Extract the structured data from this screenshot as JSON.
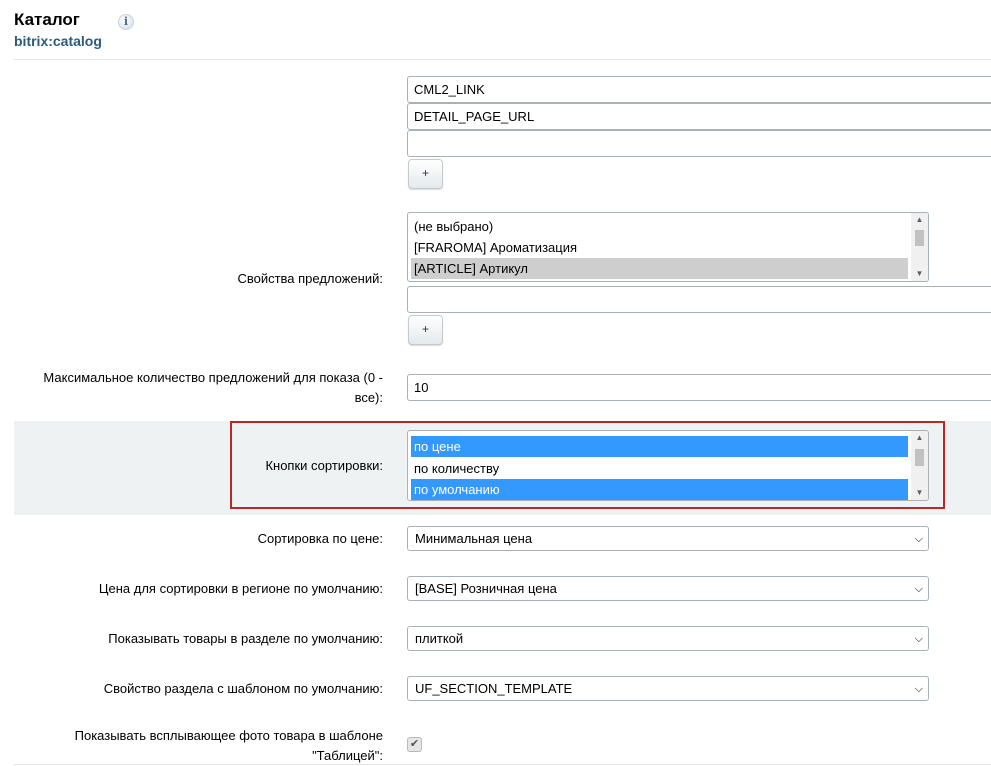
{
  "header": {
    "title": "Каталог",
    "subtitle": "bitrix:catalog",
    "info_icon": "i"
  },
  "offer_link_fields": {
    "values": [
      "CML2_LINK",
      "DETAIL_PAGE_URL",
      ""
    ],
    "add_label": "+"
  },
  "offer_properties": {
    "label": "Свойства предложений:",
    "options": [
      "(не выбрано)",
      "[FRAROMA] Ароматизация",
      "[ARTICLE] Артикул"
    ],
    "selected_index": 2,
    "extra_input": "",
    "add_label": "+"
  },
  "max_offers": {
    "label_line1": "Максимальное количество предложений для показа (0 -",
    "label_line2": "все):",
    "value": "10"
  },
  "sort_buttons": {
    "label": "Кнопки сортировки:",
    "options": [
      "по цене",
      "по количеству",
      "по умолчанию"
    ],
    "selected": [
      true,
      false,
      true
    ]
  },
  "price_sort": {
    "label": "Сортировка по цене:",
    "value": "Минимальная цена"
  },
  "region_price": {
    "label": "Цена для сортировки в регионе по умолчанию:",
    "value": "[BASE] Розничная цена"
  },
  "section_view": {
    "label": "Показывать товары в разделе по умолчанию:",
    "value": "плиткой"
  },
  "section_template": {
    "label": "Свойство раздела с шаблоном по умолчанию:",
    "value": "UF_SECTION_TEMPLATE"
  },
  "popup_photo": {
    "label_line1": "Показывать всплывающее фото товара в шаблоне",
    "label_line2": "\"Таблицей\":",
    "checked": true
  },
  "colors": {
    "accent_blue": "#3399ff",
    "frame_red": "#b9262b",
    "subtitle_blue": "#2c5a7c"
  }
}
